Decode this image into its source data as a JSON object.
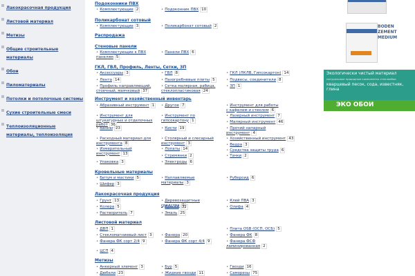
{
  "sidebar": {
    "items": [
      {
        "label": "Лакокрасочная продукция"
      },
      {
        "label": "Листовой материал"
      },
      {
        "label": "Метизы"
      },
      {
        "label": "Общие строительные материалы"
      },
      {
        "label": "Обои"
      },
      {
        "label": "Пиломатериалы"
      },
      {
        "label": "Потолки и потолочные системы"
      },
      {
        "label": "Сухие строительные смеси"
      },
      {
        "label": "Теплоизоляционные материалы, теплоизоляция"
      }
    ]
  },
  "main": {
    "sections": [
      {
        "title": "Подоконники ПВХ"
      },
      {
        "title": "Поликарбонат сотовый"
      },
      {
        "title": "Распродажа"
      },
      {
        "title": "Стеновые панели"
      },
      {
        "title": "ГКЛ, ГВЛ, Профиль, Ленты, Сетки, ЗП"
      },
      {
        "title": "Инструмент и хозяйственный инвентарь"
      },
      {
        "title": "Кровельные материалы"
      },
      {
        "title": "Лакокрасочная продукция"
      },
      {
        "title": "Листовой материал"
      },
      {
        "title": "Метизы"
      }
    ],
    "items": [
      {
        "name": "Комплектующие",
        "count": "2"
      },
      {
        "name": "Подоконник ПВХ",
        "count": "10"
      },
      {
        "name": "Комплектующие",
        "count": "3"
      },
      {
        "name": "Поликарбонат сотовый",
        "count": "2"
      },
      {
        "name": "Комплектующие к ПВХ панелям",
        "count": "5"
      },
      {
        "name": "Панели ПВХ",
        "count": "6"
      },
      {
        "name": "Аксессуары",
        "count": "3"
      },
      {
        "name": "ГВЛ",
        "count": "8"
      },
      {
        "name": "ГКЛ (ЛКЛВ, Гипсокартон)",
        "count": "14"
      },
      {
        "name": "Лента",
        "count": "14"
      },
      {
        "name": "Пазогребневые плиты",
        "count": "5"
      },
      {
        "name": "Подвесы, соединители",
        "count": "8"
      },
      {
        "name": "Профиль направляющий, стоечный, маячковый",
        "count": "37"
      },
      {
        "name": "Сетка малярная, рабица, стеклопластиковая",
        "count": "24"
      },
      {
        "name": "ЗП",
        "count": "1"
      },
      {
        "name": "Абразивный инструмент",
        "count": "1"
      },
      {
        "name": "Другое",
        "count": "7"
      },
      {
        "name": "Инструмент для работы с кафелем и стеклом",
        "count": "6"
      },
      {
        "name": "Инструмент для штукатурных и отделочных работ",
        "count": "36"
      },
      {
        "name": "Инструмент по гипсокартону",
        "count": "1"
      },
      {
        "name": "Лазерный инструмент",
        "count": "7"
      },
      {
        "name": "Малярный инструмент",
        "count": "46"
      },
      {
        "name": "Ванны",
        "count": "23"
      },
      {
        "name": "Кисти",
        "count": "19"
      },
      {
        "name": "Прочий напарный инструмент",
        "count": "4"
      },
      {
        "name": "Расходный материал для инструмента",
        "count": "8"
      },
      {
        "name": "Столярный и слесарный инструмент",
        "count": "3"
      },
      {
        "name": "Хозяйственный инструмент",
        "count": "43"
      },
      {
        "name": "Ведра",
        "count": "3"
      },
      {
        "name": "Измерительный инструмент",
        "count": "13"
      },
      {
        "name": "Лопаты",
        "count": "14"
      },
      {
        "name": "Средства защиты труда",
        "count": "6"
      },
      {
        "name": "Стремянки",
        "count": "2"
      },
      {
        "name": "Тачки",
        "count": "2"
      },
      {
        "name": "Упаковка",
        "count": "3"
      },
      {
        "name": "Электроды",
        "count": "6"
      },
      {
        "name": "Битум и мастики",
        "count": "5"
      },
      {
        "name": "Наплавляемые материалы",
        "count": "3"
      },
      {
        "name": "Рубероид",
        "count": "6"
      },
      {
        "name": "Шифер",
        "count": "3"
      },
      {
        "name": "Грунт",
        "count": "13"
      },
      {
        "name": "Деревозащитные средства",
        "count": "5"
      },
      {
        "name": "Клей ПВА",
        "count": "3"
      },
      {
        "name": "Колера",
        "count": "5"
      },
      {
        "name": "Краска",
        "count": "32"
      },
      {
        "name": "Олифа",
        "count": "4"
      },
      {
        "name": "Растворитель",
        "count": "7"
      },
      {
        "name": "Эмаль",
        "count": "25"
      },
      {
        "name": "ДВП",
        "count": "1"
      },
      {
        "name": "Плита OSB (ОСП, ОСБ)",
        "count": "5"
      },
      {
        "name": "Стекломагниевый лист",
        "count": "3"
      },
      {
        "name": "Фанера",
        "count": "20"
      },
      {
        "name": "Фанера ФК",
        "count": "8"
      },
      {
        "name": "Фанера ФК сорт 2/4",
        "count": "9"
      },
      {
        "name": "Фанера ФК сорт 4/4",
        "count": "9"
      },
      {
        "name": "Фанера ФСФ ламинированная",
        "count": "2"
      },
      {
        "name": "ЦСП",
        "count": "4"
      },
      {
        "name": "Анкерный элемент",
        "count": "3"
      },
      {
        "name": "Бур",
        "count": "5"
      },
      {
        "name": "Гвозди",
        "count": "16"
      },
      {
        "name": "Дюбели",
        "count": "23"
      },
      {
        "name": "Жидкие гвозди",
        "count": "11"
      },
      {
        "name": "Саморезы",
        "count": "75"
      }
    ]
  },
  "right": {
    "product_text": [
      "BODEN",
      "ZEMENT",
      "MEDIUM"
    ],
    "banner": {
      "headline": "Экологически чистый материал",
      "sub": "натуральные природные компоненты стеклообои",
      "body": "кварцевый песок, сода, известняк, глина",
      "logo": "ЭКО ОБОИ"
    }
  },
  "colors": {
    "link": "#1e4f96",
    "sidebar_bg": "#eef0f3",
    "banner_bg": "#2c9d8a",
    "grass": "#4fae32"
  }
}
